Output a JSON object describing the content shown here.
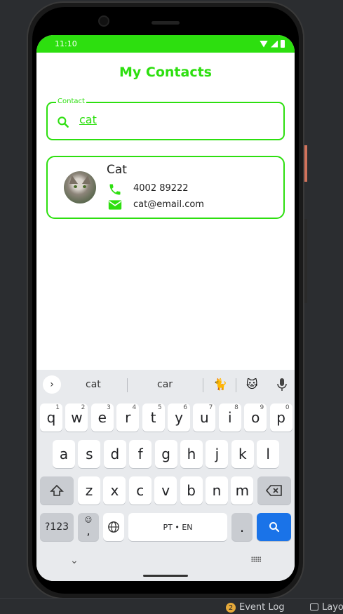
{
  "status_bar": {
    "time": "11:10"
  },
  "app": {
    "title": "My Contacts"
  },
  "search": {
    "label": "Contact",
    "value": "cat",
    "icon": "search-icon"
  },
  "contacts": [
    {
      "name": "Cat",
      "phone": "4002 89222",
      "email": "cat@email.com"
    }
  ],
  "keyboard": {
    "suggestions": [
      "cat",
      "car"
    ],
    "emoji": [
      "🐈",
      "🐱"
    ],
    "row1": [
      {
        "k": "q",
        "s": "1"
      },
      {
        "k": "w",
        "s": "2"
      },
      {
        "k": "e",
        "s": "3"
      },
      {
        "k": "r",
        "s": "4"
      },
      {
        "k": "t",
        "s": "5"
      },
      {
        "k": "y",
        "s": "6"
      },
      {
        "k": "u",
        "s": "7"
      },
      {
        "k": "i",
        "s": "8"
      },
      {
        "k": "o",
        "s": "9"
      },
      {
        "k": "p",
        "s": "0"
      }
    ],
    "row2": [
      "a",
      "s",
      "d",
      "f",
      "g",
      "h",
      "j",
      "k",
      "l"
    ],
    "row3": [
      "z",
      "x",
      "c",
      "v",
      "b",
      "n",
      "m"
    ],
    "symbols_label": "?123",
    "comma_label": ",",
    "space_label": "PT • EN",
    "period_label": "."
  },
  "ide": {
    "event_count": "2",
    "event_label": "Event Log",
    "layout_label": "Layo"
  },
  "colors": {
    "accent": "#2ddf0f",
    "key_blue": "#1a73e8"
  }
}
